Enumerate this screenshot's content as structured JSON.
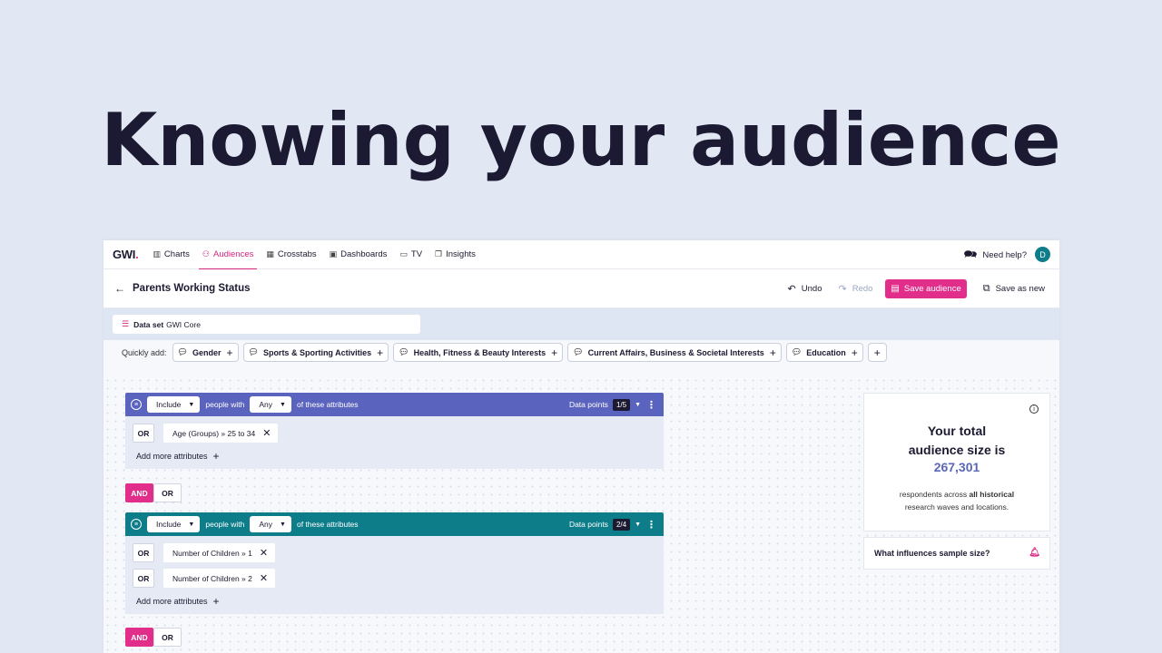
{
  "hero": {
    "title": "Knowing your audience"
  },
  "nav": {
    "logo": "GWI",
    "items": [
      {
        "label": "Charts",
        "icon": "bar-chart-icon"
      },
      {
        "label": "Audiences",
        "icon": "people-icon",
        "active": true
      },
      {
        "label": "Crosstabs",
        "icon": "grid-icon"
      },
      {
        "label": "Dashboards",
        "icon": "dashboard-icon"
      },
      {
        "label": "TV",
        "icon": "tv-icon"
      },
      {
        "label": "Insights",
        "icon": "insights-icon"
      }
    ],
    "help": "Need help?",
    "avatar": "D"
  },
  "titlebar": {
    "title": "Parents Working Status",
    "undo": "Undo",
    "redo": "Redo",
    "save": "Save audience",
    "save_new": "Save as new"
  },
  "dataset": {
    "label": "Data set",
    "value": "GWI Core"
  },
  "quick_add": {
    "label": "Quickly add:",
    "chips": [
      "Gender",
      "Sports & Sporting Activities",
      "Health, Fitness & Beauty Interests",
      "Current Affairs, Business & Societal Interests",
      "Education"
    ]
  },
  "groups": [
    {
      "include": "Include",
      "people_with": "people with",
      "match": "Any",
      "of_these": "of these attributes",
      "data_points_label": "Data points",
      "data_points": "1/5",
      "color": "#5a63bd",
      "rows": [
        {
          "op": "OR",
          "attr": "Age (Groups) » 25 to 34"
        }
      ],
      "add_more": "Add more attributes"
    },
    {
      "include": "Include",
      "people_with": "people with",
      "match": "Any",
      "of_these": "of these attributes",
      "data_points_label": "Data points",
      "data_points": "2/4",
      "color": "#0e7d8a",
      "rows": [
        {
          "op": "OR",
          "attr": "Number of Children » 1"
        },
        {
          "op": "OR",
          "attr": "Number of Children » 2"
        }
      ],
      "add_more": "Add more attributes"
    }
  ],
  "logic": {
    "and": "AND",
    "or": "OR"
  },
  "size_panel": {
    "heading_line1": "Your total",
    "heading_line2": "audience size is",
    "value": "267,301",
    "sub_prefix": "respondents across",
    "sub_bold": "all historical",
    "sub_line2": "research waves and locations."
  },
  "influence": {
    "label": "What influences sample size?"
  }
}
